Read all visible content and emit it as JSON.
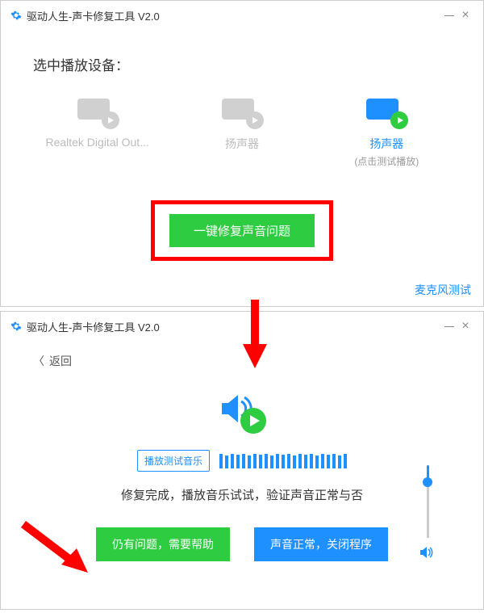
{
  "colors": {
    "green": "#2ecc40",
    "blue": "#1e90ff",
    "red": "#ff0000"
  },
  "window1": {
    "title": "驱动人生-声卡修复工具 V2.0",
    "section_title": "选中播放设备：",
    "devices": [
      {
        "name": "Realtek Digital Out...",
        "hint": "",
        "active": false
      },
      {
        "name": "扬声器",
        "hint": "",
        "active": false
      },
      {
        "name": "扬声器",
        "hint": "(点击测试播放)",
        "active": true
      }
    ],
    "fix_button": "一键修复声音问题",
    "mic_test_link": "麦克风测试"
  },
  "window2": {
    "title": "驱动人生-声卡修复工具 V2.0",
    "back_label": "返回",
    "play_music_btn": "播放测试音乐",
    "status_text": "修复完成，播放音乐试试，验证声音正常与否",
    "help_button": "仍有问题，需要帮助",
    "ok_button": "声音正常，关闭程序",
    "eq_bars": [
      18,
      16,
      18,
      17,
      18,
      16,
      18,
      17,
      18,
      16,
      18,
      17,
      18,
      16,
      18,
      17,
      18,
      16,
      18,
      17,
      18,
      16,
      18
    ],
    "volume_percent": 80
  }
}
